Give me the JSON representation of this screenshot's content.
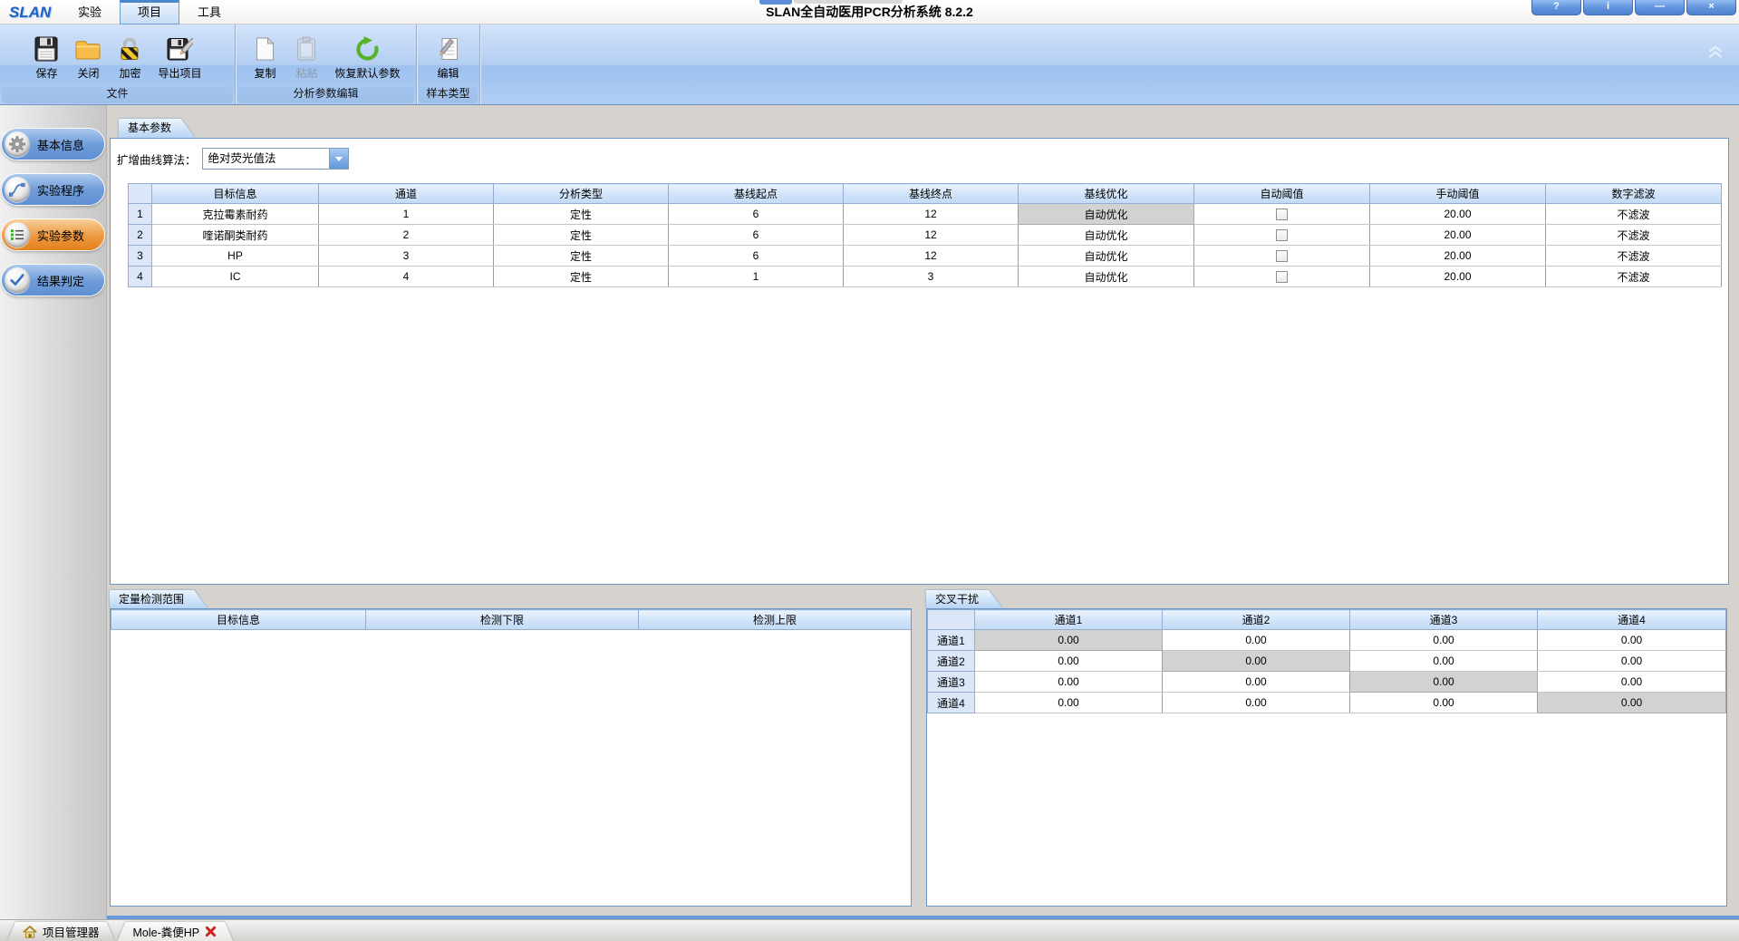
{
  "window": {
    "logo": "SLAN",
    "title": "SLAN全自动医用PCR分析系统 8.2.2",
    "menus": [
      {
        "label": "实验",
        "name": "menu-experiment",
        "active": false
      },
      {
        "label": "项目",
        "name": "menu-project",
        "active": true
      },
      {
        "label": "工具",
        "name": "menu-tools",
        "active": false
      }
    ],
    "controls": [
      {
        "glyph": "?",
        "name": "help-button"
      },
      {
        "glyph": "i",
        "name": "info-button"
      },
      {
        "glyph": "—",
        "name": "minimize-button"
      },
      {
        "glyph": "×",
        "name": "close-button"
      }
    ]
  },
  "ribbon": {
    "groups": [
      {
        "label": "文件",
        "buttons": [
          {
            "label": "保存",
            "icon": "save",
            "enabled": true
          },
          {
            "label": "关闭",
            "icon": "folder",
            "enabled": true
          },
          {
            "label": "加密",
            "icon": "lock",
            "enabled": true
          },
          {
            "label": "导出项目",
            "icon": "export",
            "enabled": true
          }
        ]
      },
      {
        "label": "分析参数编辑",
        "buttons": [
          {
            "label": "复制",
            "icon": "copy",
            "enabled": true
          },
          {
            "label": "粘贴",
            "icon": "paste",
            "enabled": false
          },
          {
            "label": "恢复默认参数",
            "icon": "restore",
            "enabled": true
          }
        ]
      },
      {
        "label": "样本类型",
        "buttons": [
          {
            "label": "编辑",
            "icon": "edit",
            "enabled": true
          }
        ]
      }
    ]
  },
  "sidebar": [
    {
      "label": "基本信息",
      "icon": "gear",
      "active": false
    },
    {
      "label": "实验程序",
      "icon": "curve",
      "active": false
    },
    {
      "label": "实验参数",
      "icon": "list",
      "active": true
    },
    {
      "label": "结果判定",
      "icon": "check",
      "active": false
    }
  ],
  "main": {
    "tab": "基本参数",
    "algorithm_label": "扩增曲线算法：",
    "algorithm_value": "绝对荧光值法",
    "table": {
      "headers": [
        "目标信息",
        "通道",
        "分析类型",
        "基线起点",
        "基线终点",
        "基线优化",
        "自动阈值",
        "手动阈值",
        "数字滤波"
      ],
      "rows": [
        {
          "num": "1",
          "target": "克拉霉素耐药",
          "channel": "1",
          "type": "定性",
          "baseline_start": "6",
          "baseline_end": "12",
          "baseline_opt": "自动优化",
          "baseline_opt_selected": true,
          "auto_threshold": false,
          "manual_threshold": "20.00",
          "filter": "不滤波"
        },
        {
          "num": "2",
          "target": "喹诺酮类耐药",
          "channel": "2",
          "type": "定性",
          "baseline_start": "6",
          "baseline_end": "12",
          "baseline_opt": "自动优化",
          "baseline_opt_selected": false,
          "auto_threshold": false,
          "manual_threshold": "20.00",
          "filter": "不滤波"
        },
        {
          "num": "3",
          "target": "HP",
          "channel": "3",
          "type": "定性",
          "baseline_start": "6",
          "baseline_end": "12",
          "baseline_opt": "自动优化",
          "baseline_opt_selected": false,
          "auto_threshold": false,
          "manual_threshold": "20.00",
          "filter": "不滤波"
        },
        {
          "num": "4",
          "target": "IC",
          "channel": "4",
          "type": "定性",
          "baseline_start": "1",
          "baseline_end": "3",
          "baseline_opt": "自动优化",
          "baseline_opt_selected": false,
          "auto_threshold": false,
          "manual_threshold": "20.00",
          "filter": "不滤波"
        }
      ]
    }
  },
  "range_panel": {
    "tab": "定量检测范围",
    "headers": [
      "目标信息",
      "检测下限",
      "检测上限"
    ],
    "rows": []
  },
  "cross_panel": {
    "tab": "交叉干扰",
    "col_headers": [
      "通道1",
      "通道2",
      "通道3",
      "通道4"
    ],
    "row_headers": [
      "通道1",
      "通道2",
      "通道3",
      "通道4"
    ],
    "values": [
      [
        "0.00",
        "0.00",
        "0.00",
        "0.00"
      ],
      [
        "0.00",
        "0.00",
        "0.00",
        "0.00"
      ],
      [
        "0.00",
        "0.00",
        "0.00",
        "0.00"
      ],
      [
        "0.00",
        "0.00",
        "0.00",
        "0.00"
      ]
    ]
  },
  "statusbar": {
    "tabs": [
      {
        "label": "项目管理器",
        "icon": "home",
        "active": false,
        "closable": false
      },
      {
        "label": "Mole-粪便HP",
        "icon": null,
        "active": true,
        "closable": true
      }
    ]
  },
  "colors": {
    "accent_blue": "#5b8dd8",
    "active_orange": "#e8872c",
    "selected_cell_gray": "#d2d2d2"
  }
}
